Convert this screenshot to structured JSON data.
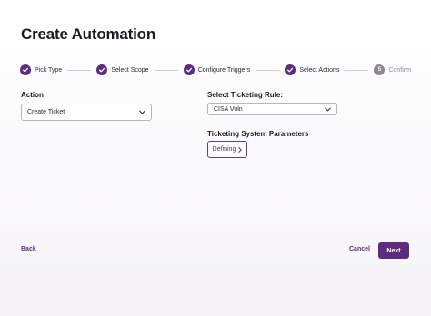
{
  "page": {
    "title": "Create Automation"
  },
  "stepper": {
    "steps": [
      {
        "label": "Pick Type",
        "state": "done",
        "icon": "check-icon"
      },
      {
        "label": "Select Scope",
        "state": "done",
        "icon": "check-icon"
      },
      {
        "label": "Configure Triggers",
        "state": "done",
        "icon": "check-icon"
      },
      {
        "label": "Select Actions",
        "state": "done",
        "icon": "check-icon"
      },
      {
        "label": "Confirm",
        "state": "pending",
        "number": "5"
      }
    ]
  },
  "action": {
    "label": "Action",
    "value": "Create Ticket"
  },
  "ticketing_rule": {
    "label": "Select Ticketing Rule:",
    "value": "CISA Vuln"
  },
  "params": {
    "label": "Ticketing System Parameters",
    "button_label": "Defining"
  },
  "footer": {
    "back_label": "Back",
    "cancel_label": "Cancel",
    "next_label": "Next"
  },
  "colors": {
    "accent": "#5e2c7c",
    "pending": "#8b8894",
    "border": "#b9b4c2"
  }
}
